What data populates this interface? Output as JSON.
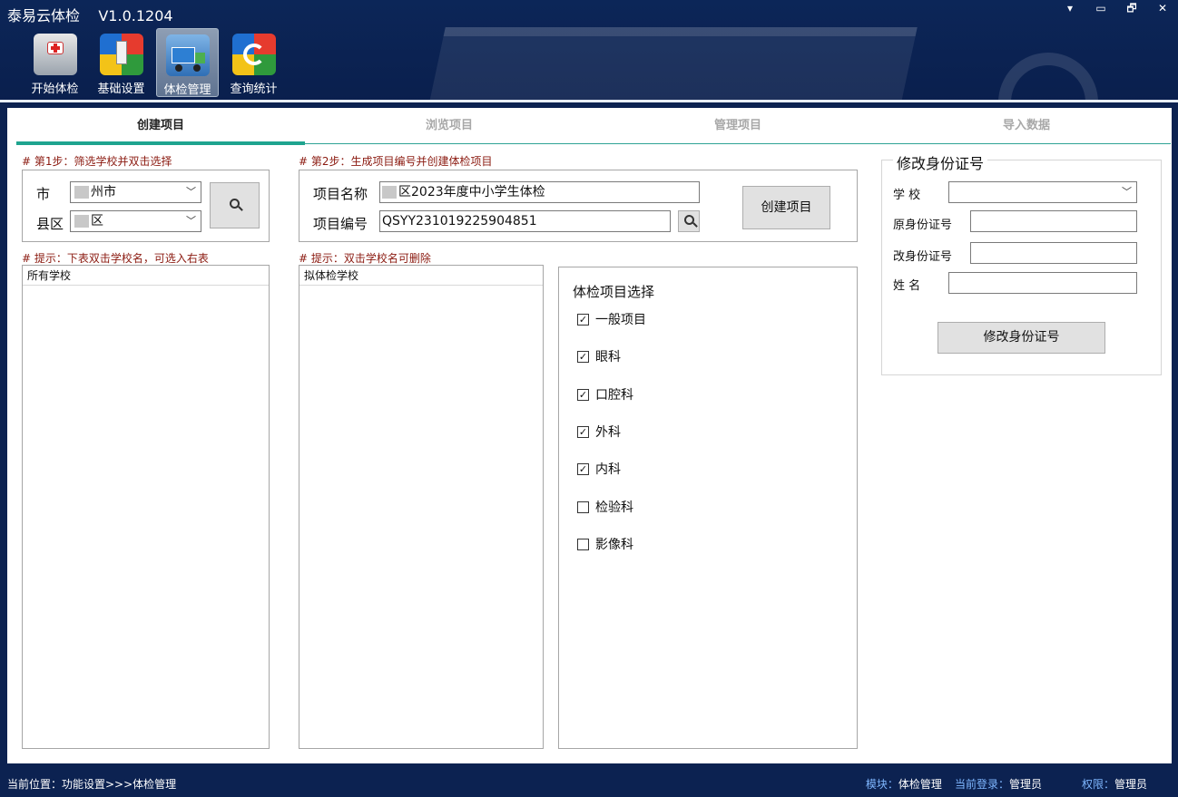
{
  "app": {
    "title": "泰易云体检",
    "version": "V1.0.1204"
  },
  "window_controls": [
    "▾",
    "▭",
    "🗗",
    "✕"
  ],
  "toolbar": [
    {
      "label": "开始体检",
      "icon": "medical-kit-icon"
    },
    {
      "label": "基础设置",
      "icon": "settings-usb-icon"
    },
    {
      "label": "体检管理",
      "icon": "truck-icon",
      "active": true
    },
    {
      "label": "查询统计",
      "icon": "refresh-stats-icon"
    }
  ],
  "tabs": [
    {
      "label": "创建项目",
      "active": true
    },
    {
      "label": "浏览项目"
    },
    {
      "label": "管理项目"
    },
    {
      "label": "导入数据"
    }
  ],
  "step1": {
    "hint": "# 第1步：筛选学校并双击选择",
    "city_label": "市",
    "city_value": "州市",
    "district_label": "县区",
    "district_value": "区"
  },
  "step1_list": {
    "hint": "# 提示：下表双击学校名，可选入右表",
    "header": "所有学校"
  },
  "step2": {
    "hint": "# 第2步：生成项目编号并创建体检项目",
    "name_label": "项目名称",
    "name_value": "区2023年度中小学生体检",
    "code_label": "项目编号",
    "code_value": "QSYY231019225904851",
    "create_button": "创建项目"
  },
  "step2_list": {
    "hint": "# 提示：双击学校名可删除",
    "header": "拟体检学校"
  },
  "exam_selection": {
    "title": "体检项目选择",
    "items": [
      {
        "label": "一般项目",
        "checked": true
      },
      {
        "label": "眼科",
        "checked": true
      },
      {
        "label": "口腔科",
        "checked": true
      },
      {
        "label": "外科",
        "checked": true
      },
      {
        "label": "内科",
        "checked": true
      },
      {
        "label": "检验科",
        "checked": false
      },
      {
        "label": "影像科",
        "checked": false
      }
    ]
  },
  "modify_id": {
    "title": "修改身份证号",
    "school_label": "学 校",
    "school_value": "",
    "old_id_label": "原身份证号",
    "old_id_value": "",
    "new_id_label": "改身份证号",
    "new_id_value": "",
    "name_label": "姓 名",
    "name_value": "",
    "button": "修改身份证号"
  },
  "status_bar": {
    "location": "当前位置：功能设置>>>体检管理",
    "module_key": "模块：",
    "module_value": "体检管理",
    "login_key": "当前登录：",
    "login_value": "管理员",
    "perm_key": "权限：",
    "perm_value": "管理员"
  }
}
